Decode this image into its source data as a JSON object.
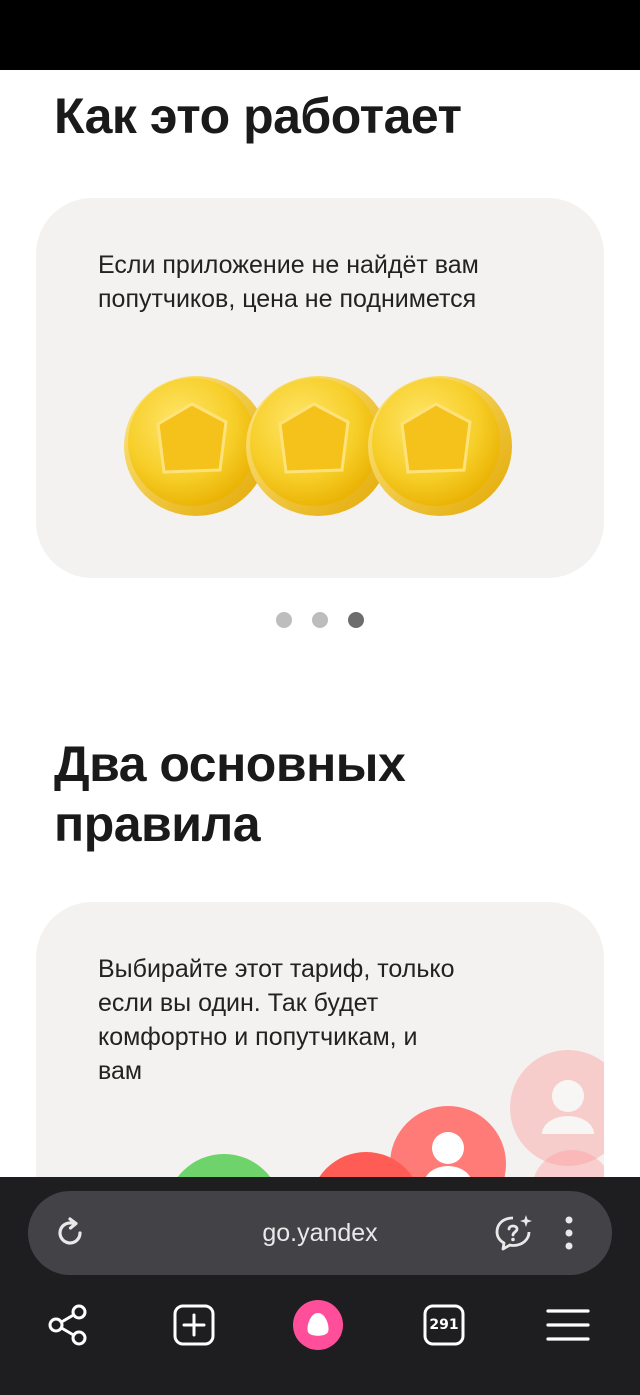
{
  "sections": {
    "how_it_works_title": "Как это работает",
    "rules_title": "Два основных правила"
  },
  "slide": {
    "text": "Если приложение не найдёт вам попутчиков, цена не поднимется",
    "dots_count": 3,
    "active_dot": 3
  },
  "rules_card": {
    "text": "Выбирайте этот тариф, только если вы один. Так будет комфортно и попутчикам, и вам"
  },
  "browser": {
    "url": "go.yandex",
    "tabs_count": "291"
  },
  "colors": {
    "coin": "#f7cf2a",
    "card_bg": "#f3f2f0",
    "alice": "#ff4f9a",
    "url_bar": "#434347"
  }
}
